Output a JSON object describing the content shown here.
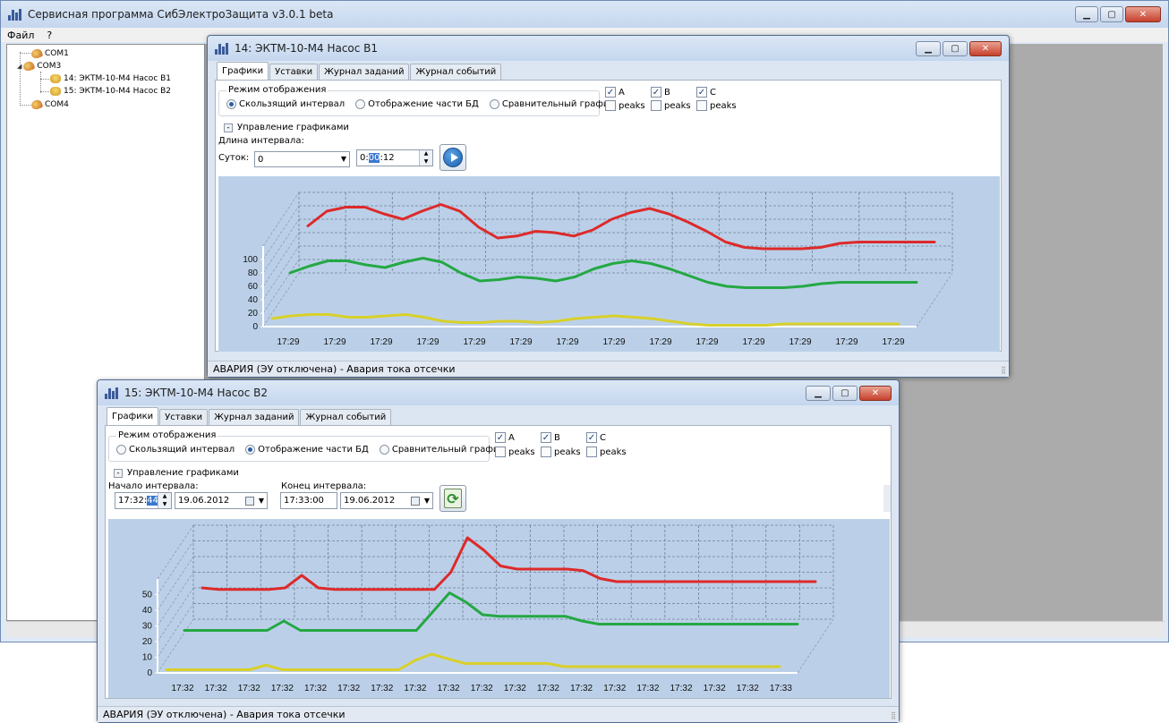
{
  "app": {
    "title": "Сервисная программа СибЭлектроЗащита v3.0.1 beta",
    "menu": [
      "Файл",
      "?"
    ],
    "window_buttons": {
      "minimize": "▁",
      "maximize": "▢",
      "close": "✕"
    }
  },
  "tree": {
    "items": [
      {
        "label": "COM1",
        "icon": "port-icon",
        "level": 0
      },
      {
        "label": "COM3",
        "icon": "port-icon",
        "level": 0,
        "expanded": true
      },
      {
        "label": "14: ЭКТМ-10-М4 Насос В1",
        "icon": "device-icon",
        "level": 1
      },
      {
        "label": "15: ЭКТМ-10-М4 Насос В2",
        "icon": "device-icon",
        "level": 1
      },
      {
        "label": "COM4",
        "icon": "port-icon",
        "level": 0
      }
    ],
    "expander": "◢"
  },
  "window1": {
    "title": "14: ЭКТМ-10-М4 Насос В1",
    "tabs": [
      "Графики",
      "Уставки",
      "Журнал заданий",
      "Журнал событий"
    ],
    "active_tab": 0,
    "mode_group_title": "Режим отображения",
    "modes": [
      "Скользящий интервал",
      "Отображение части БД",
      "Сравнительный график"
    ],
    "selected_mode": 0,
    "phases": [
      {
        "label": "A",
        "checked": true,
        "peaks_label": "peaks",
        "peaks_checked": false
      },
      {
        "label": "B",
        "checked": true,
        "peaks_label": "peaks",
        "peaks_checked": false
      },
      {
        "label": "C",
        "checked": true,
        "peaks_label": "peaks",
        "peaks_checked": false
      }
    ],
    "collapse_symbol": "-",
    "manage_label": "Управление графиками",
    "interval_label": "Длина интервала:",
    "days_label": "Суток:",
    "days_value": "0",
    "time_pre": "0:",
    "time_sel": "00",
    "time_post": ":12",
    "status": "АВАРИЯ (ЭУ отключена)  - Авария тока отсечки"
  },
  "window2": {
    "title": "15: ЭКТМ-10-М4 Насос В2",
    "tabs": [
      "Графики",
      "Уставки",
      "Журнал заданий",
      "Журнал событий"
    ],
    "active_tab": 0,
    "mode_group_title": "Режим отображения",
    "modes": [
      "Скользящий интервал",
      "Отображение части БД",
      "Сравнительный график"
    ],
    "selected_mode": 1,
    "phases": [
      {
        "label": "A",
        "checked": true,
        "peaks_label": "peaks",
        "peaks_checked": false
      },
      {
        "label": "B",
        "checked": true,
        "peaks_label": "peaks",
        "peaks_checked": false
      },
      {
        "label": "C",
        "checked": true,
        "peaks_label": "peaks",
        "peaks_checked": false
      }
    ],
    "collapse_symbol": "-",
    "manage_label": "Управление графиками",
    "start_label": "Начало интервала:",
    "start_time_pre": "17:32:",
    "start_time_sel": "44",
    "start_date": "19.06.2012",
    "end_label": "Конец интервала:",
    "end_time": "17:33:00",
    "end_date": "19.06.2012",
    "status": "АВАРИЯ (ЭУ отключена)  - Авария тока отсечки"
  },
  "chart_data": [
    {
      "type": "line",
      "title": "",
      "y_ticks": [
        0,
        20,
        40,
        60,
        80,
        100
      ],
      "ylim": [
        0,
        120
      ],
      "x_tick_labels": [
        "17:29",
        "17:29",
        "17:29",
        "17:29",
        "17:29",
        "17:29",
        "17:29",
        "17:29",
        "17:29",
        "17:29",
        "17:29",
        "17:29",
        "17:29",
        "17:29"
      ],
      "grid": true,
      "series": [
        {
          "color": "#dd2a2a",
          "values": [
            70,
            92,
            98,
            98,
            88,
            80,
            92,
            102,
            92,
            68,
            52,
            55,
            62,
            60,
            55,
            64,
            80,
            90,
            96,
            88,
            76,
            62,
            46,
            38,
            36,
            36,
            36,
            38,
            44,
            46,
            46,
            46,
            46,
            46
          ]
        },
        {
          "color": "#24a844",
          "values": [
            40,
            50,
            58,
            58,
            52,
            48,
            56,
            62,
            56,
            40,
            28,
            30,
            34,
            32,
            28,
            34,
            46,
            54,
            58,
            54,
            46,
            36,
            26,
            20,
            18,
            18,
            18,
            20,
            24,
            26,
            26,
            26,
            26,
            26
          ]
        },
        {
          "color": "#d8d02a",
          "values": [
            12,
            16,
            18,
            18,
            14,
            14,
            16,
            18,
            14,
            8,
            6,
            6,
            8,
            8,
            6,
            8,
            12,
            14,
            16,
            14,
            12,
            8,
            4,
            2,
            2,
            2,
            2,
            4,
            4,
            4,
            4,
            4,
            4,
            4
          ]
        }
      ]
    },
    {
      "type": "line",
      "title": "",
      "y_ticks": [
        0,
        10,
        20,
        30,
        40,
        50
      ],
      "ylim": [
        0,
        60
      ],
      "x_tick_labels": [
        "17:32",
        "17:32",
        "17:32",
        "17:32",
        "17:32",
        "17:32",
        "17:32",
        "17:32",
        "17:32",
        "17:32",
        "17:32",
        "17:32",
        "17:32",
        "17:32",
        "17:32",
        "17:32",
        "17:32",
        "17:32",
        "17:33"
      ],
      "grid": true,
      "series": [
        {
          "color": "#dd2a2a",
          "values": [
            20,
            19,
            19,
            19,
            19,
            20,
            28,
            20,
            19,
            19,
            19,
            19,
            19,
            19,
            19,
            30,
            52,
            44,
            34,
            32,
            32,
            32,
            32,
            31,
            26,
            24,
            24,
            24,
            24,
            24,
            24,
            24,
            24,
            24,
            24,
            24,
            24,
            24
          ]
        },
        {
          "color": "#24a844",
          "values": [
            10,
            10,
            10,
            10,
            10,
            10,
            16,
            10,
            10,
            10,
            10,
            10,
            10,
            10,
            10,
            22,
            34,
            28,
            20,
            19,
            19,
            19,
            19,
            19,
            16,
            14,
            14,
            14,
            14,
            14,
            14,
            14,
            14,
            14,
            14,
            14,
            14,
            14
          ]
        },
        {
          "color": "#d8d02a",
          "values": [
            2,
            2,
            2,
            2,
            2,
            2,
            5,
            2,
            2,
            2,
            2,
            2,
            2,
            2,
            2,
            8,
            12,
            9,
            6,
            6,
            6,
            6,
            6,
            6,
            4,
            4,
            4,
            4,
            4,
            4,
            4,
            4,
            4,
            4,
            4,
            4,
            4,
            4
          ]
        }
      ]
    }
  ]
}
